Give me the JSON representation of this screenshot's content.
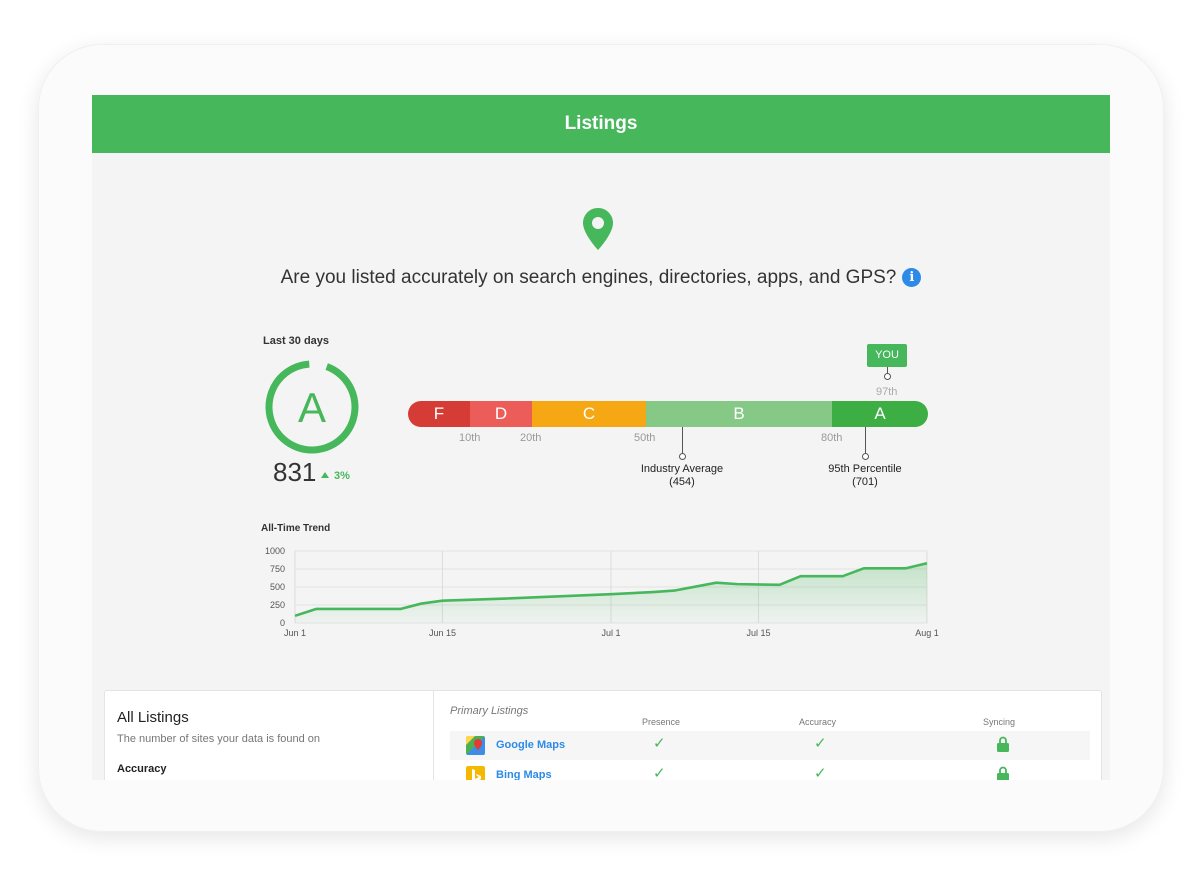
{
  "header": {
    "title": "Listings"
  },
  "question": "Are you listed accurately on search engines, directories, apps, and GPS?",
  "score_card": {
    "period": "Last 30 days",
    "grade": "A",
    "score": "831",
    "change": "3%"
  },
  "grade_scale": {
    "segments": [
      {
        "grade": "F",
        "color": "#d53c35"
      },
      {
        "grade": "D",
        "color": "#ec5d5a"
      },
      {
        "grade": "C",
        "color": "#f5a814"
      },
      {
        "grade": "B",
        "color": "#86c986"
      },
      {
        "grade": "A",
        "color": "#3cae44"
      }
    ],
    "ticks": [
      "10th",
      "20th",
      "50th",
      "80th"
    ],
    "you_label": "YOU",
    "you_percentile": "97th",
    "industry_average": {
      "label": "Industry Average",
      "value": "(454)"
    },
    "percentile_95": {
      "label": "95th Percentile",
      "value": "(701)"
    }
  },
  "trend": {
    "title": "All-Time Trend"
  },
  "chart_data": {
    "type": "area",
    "title": "All-Time Trend",
    "x_ticks": [
      "Jun 1",
      "Jun 15",
      "Jul 1",
      "Jul 15",
      "Aug 1"
    ],
    "y_ticks": [
      "0",
      "250",
      "500",
      "750",
      "1000"
    ],
    "ylim": [
      0,
      1000
    ],
    "grid": true,
    "x": [
      1,
      3,
      5,
      11,
      13,
      15,
      21,
      31,
      35,
      37,
      41,
      43,
      47,
      49,
      53,
      55,
      59,
      61
    ],
    "series": [
      {
        "values": [
          100,
          195,
          195,
          195,
          270,
          310,
          340,
          400,
          430,
          450,
          560,
          540,
          530,
          650,
          650,
          760,
          760,
          830
        ]
      }
    ]
  },
  "all_listings": {
    "title": "All Listings",
    "subtitle": "The number of sites your data is found on",
    "accuracy_label": "Accuracy"
  },
  "primary_listings": {
    "title": "Primary Listings",
    "columns": [
      "Presence",
      "Accuracy",
      "Syncing"
    ],
    "rows": [
      {
        "name": "Google Maps",
        "icon": "google-maps-icon"
      },
      {
        "name": "Bing Maps",
        "icon": "bing-maps-icon"
      }
    ]
  },
  "colors": {
    "brand": "#46b75b",
    "link": "#2d8ae6",
    "info": "#2d8ae6"
  }
}
